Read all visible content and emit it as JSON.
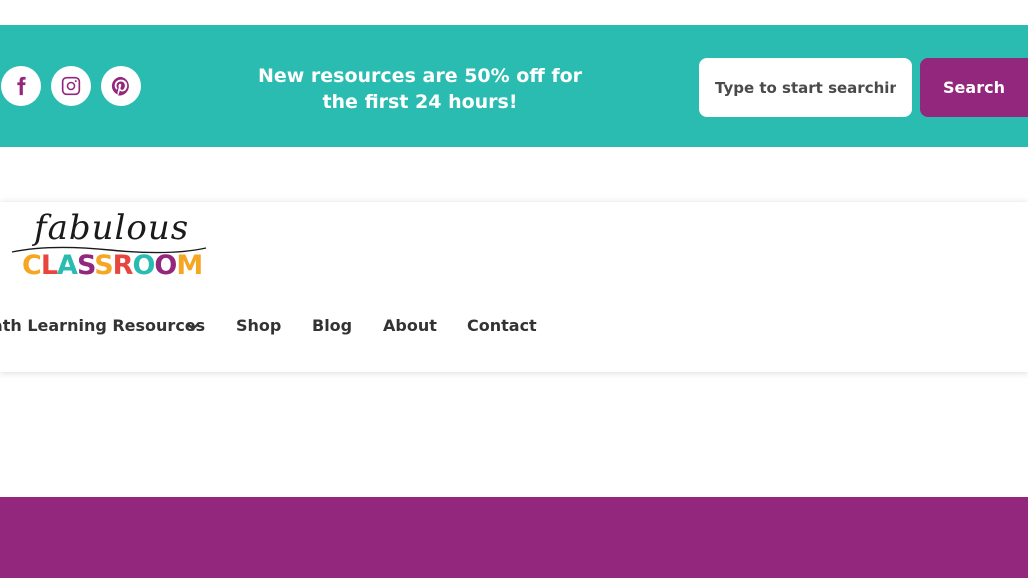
{
  "social": {
    "facebook": "facebook-icon",
    "instagram": "instagram-icon",
    "pinterest": "pinterest-icon"
  },
  "promo": {
    "line1": "New resources are 50% off for",
    "line2": "the first 24 hours!"
  },
  "search": {
    "placeholder": "Type to start searching...",
    "button_label": "Search"
  },
  "logo": {
    "script": "fabulous",
    "word_letters": [
      "C",
      "L",
      "A",
      "S",
      "S",
      "R",
      "O",
      "O",
      "M"
    ],
    "word_colors": [
      "#f5a623",
      "#e8453c",
      "#2bbcb1",
      "#93267d",
      "#f5a623",
      "#e8453c",
      "#2bbcb1",
      "#93267d",
      "#f5a623"
    ]
  },
  "nav": {
    "items": [
      {
        "label": "Math Learning Resources",
        "has_dropdown": true
      },
      {
        "label": "Shop"
      },
      {
        "label": "Blog"
      },
      {
        "label": "About"
      },
      {
        "label": "Contact"
      }
    ]
  },
  "colors": {
    "teal": "#2bbcb1",
    "purple": "#93267d",
    "text": "#333333"
  }
}
